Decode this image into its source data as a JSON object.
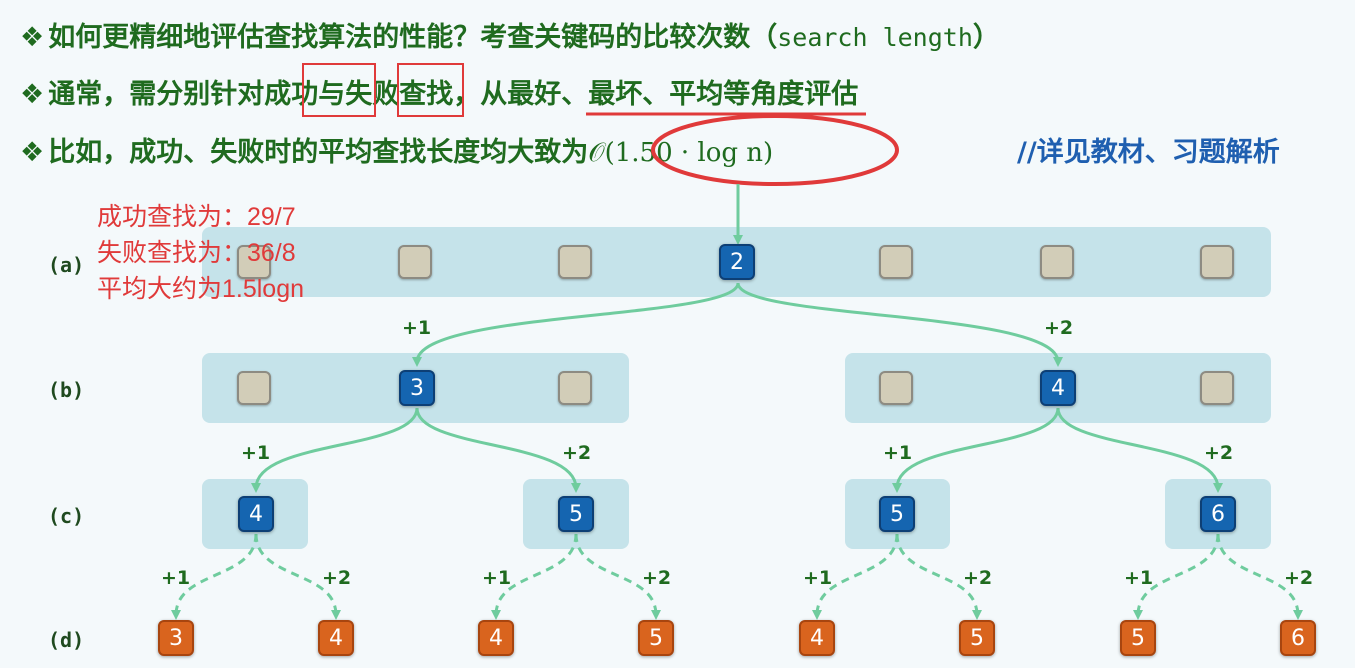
{
  "bullet": "❖",
  "line1": {
    "text": "如何更精细地评估查找算法的性能？考查关键码的比较次数（",
    "mono": "search length",
    "end": "）"
  },
  "line2": {
    "p1": "通常，需分别针对",
    "success": "成功",
    "p2": "与",
    "fail": "失败",
    "p3": "查找，从",
    "best": "最好",
    "sep1": "、",
    "worst": "最坏",
    "sep2": "、",
    "avg": "平均",
    "p4": "等角度评估"
  },
  "line3": {
    "text": "比如，成功、失败时的平均查找长度均大致为",
    "math": "𝒪(1.50 · log n)"
  },
  "reference": "//详见教材、习题解析",
  "annotations": [
    "成功查找为：29/7",
    "失败查找为：36/8",
    "平均大约为1.5logn"
  ],
  "rows": [
    "(a)",
    "(b)",
    "(c)",
    "(d)"
  ],
  "nodes": {
    "a_root": "2",
    "b_left": "3",
    "b_right": "4",
    "c": [
      "4",
      "5",
      "5",
      "6"
    ],
    "d": [
      "3",
      "4",
      "4",
      "5",
      "4",
      "5",
      "5",
      "6"
    ]
  },
  "increments": {
    "b": [
      "+1",
      "+2"
    ],
    "c": [
      "+1",
      "+2",
      "+1",
      "+2"
    ],
    "d": [
      "+1",
      "+2",
      "+1",
      "+2",
      "+1",
      "+2",
      "+1",
      "+2"
    ]
  },
  "colors": {
    "title": "#1f6b1f",
    "reference": "#1f5fb0",
    "highlight": "#e03a3a",
    "node_blue": "#1565b0",
    "node_orange": "#d9641e",
    "arrow": "#6fcc9e",
    "band": "#c5e3ea"
  }
}
